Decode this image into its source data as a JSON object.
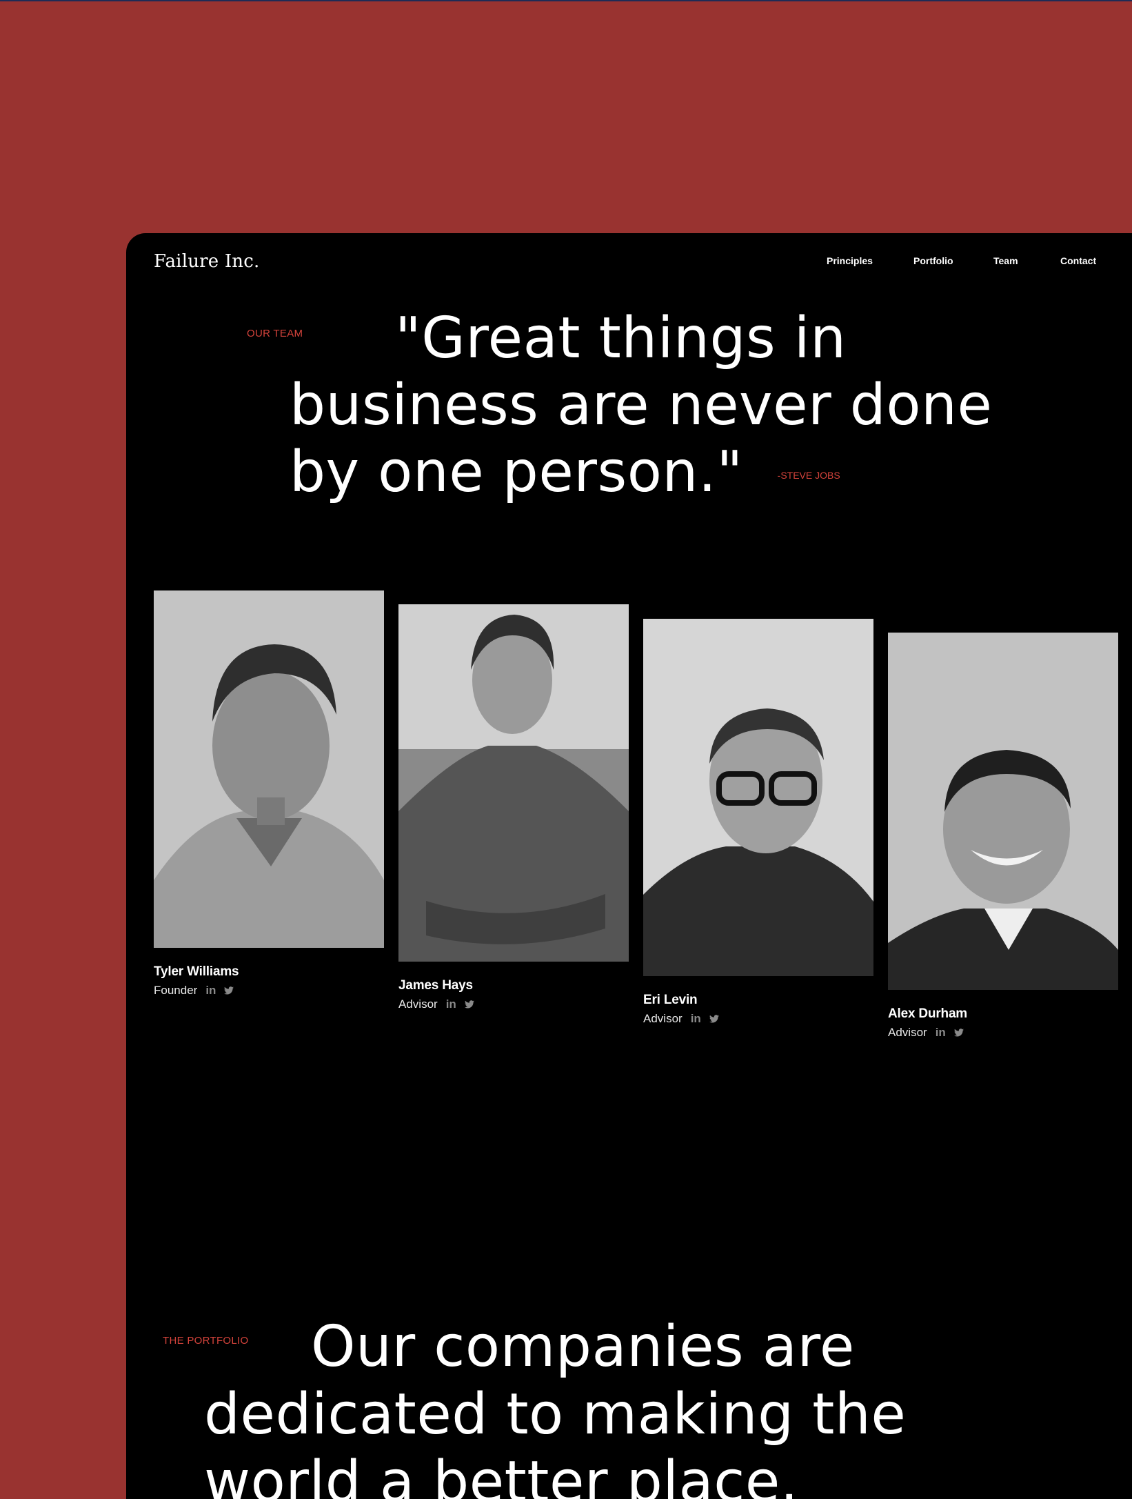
{
  "site": {
    "logo": "Failure Inc."
  },
  "nav": {
    "items": [
      "Principles",
      "Portfolio",
      "Team",
      "Contact"
    ]
  },
  "team_section": {
    "eyebrow": "OUR TEAM",
    "quote": "\"Great things in business are never done by one person.\"",
    "attribution": "-STEVE JOBS"
  },
  "members": [
    {
      "name": "Tyler Williams",
      "role": "Founder",
      "linkedin": "in"
    },
    {
      "name": "James Hays",
      "role": "Advisor",
      "linkedin": "in"
    },
    {
      "name": "Eri Levin",
      "role": "Advisor",
      "linkedin": "in"
    },
    {
      "name": "Alex Durham",
      "role": "Advisor",
      "linkedin": "in"
    }
  ],
  "portfolio_section": {
    "eyebrow": "THE PORTFOLIO",
    "heading": "Our companies are dedicated to making the world a better place."
  },
  "colors": {
    "background": "#993330",
    "screen": "#000000",
    "accent": "#d4433b",
    "text": "#ffffff"
  }
}
